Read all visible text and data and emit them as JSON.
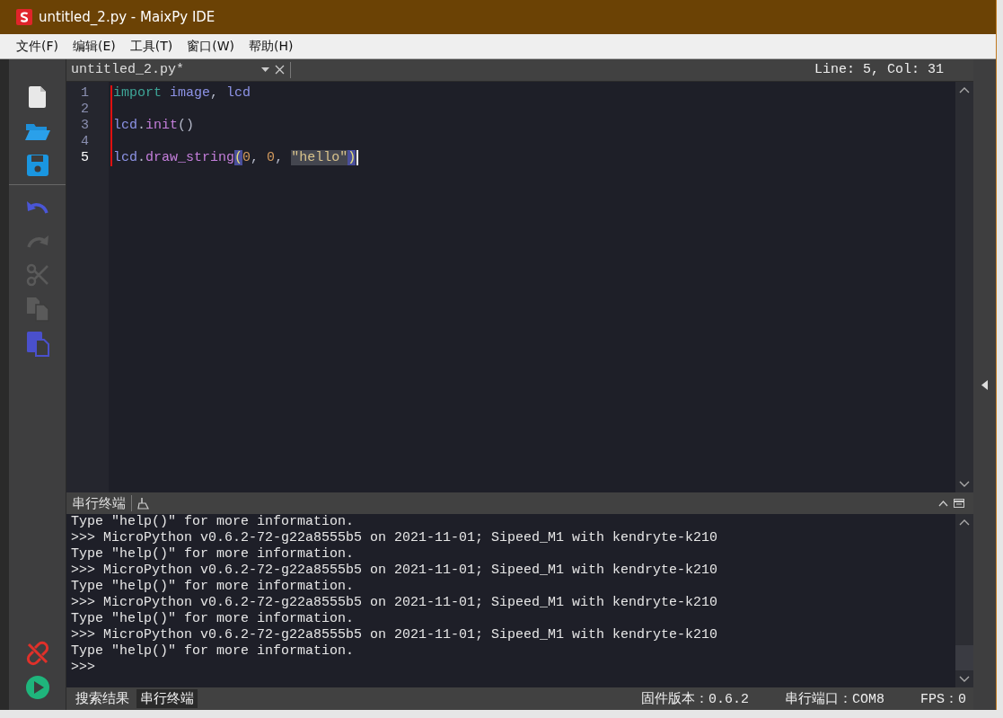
{
  "window": {
    "title": "untitled_2.py - MaixPy IDE"
  },
  "menu": [
    "文件(F)",
    "编辑(E)",
    "工具(T)",
    "窗口(W)",
    "帮助(H)"
  ],
  "toolbar": [
    {
      "kind": "new",
      "disabled": false
    },
    {
      "kind": "open",
      "disabled": false
    },
    {
      "kind": "save",
      "disabled": false
    },
    {
      "kind": "undo",
      "disabled": false
    },
    {
      "kind": "redo",
      "disabled": true
    },
    {
      "kind": "cut",
      "disabled": true
    },
    {
      "kind": "copy",
      "disabled": true
    },
    {
      "kind": "paste",
      "disabled": false
    }
  ],
  "device_buttons": [
    {
      "kind": "disconnect"
    },
    {
      "kind": "run"
    }
  ],
  "editor": {
    "tab": "untitled_2.py*",
    "position": "Line: 5, Col: 31",
    "lines": [
      {
        "number": "1",
        "current": false,
        "tokens": [
          {
            "text": "import",
            "kind": "keyword"
          },
          {
            "text": " image",
            "kind": "name"
          },
          {
            "text": ", ",
            "kind": "plain"
          },
          {
            "text": "lcd",
            "kind": "name"
          }
        ]
      },
      {
        "number": "2",
        "current": false
      },
      {
        "number": "3",
        "current": false,
        "tokens": [
          {
            "text": "lcd",
            "kind": "name"
          },
          {
            "text": ".",
            "kind": "plain"
          },
          {
            "text": "init",
            "kind": "func"
          },
          {
            "text": "()",
            "kind": "plain"
          }
        ]
      },
      {
        "number": "4",
        "current": false
      },
      {
        "number": "5",
        "current": true,
        "tokens": [
          {
            "text": "lcd",
            "kind": "name"
          },
          {
            "text": ".",
            "kind": "plain"
          },
          {
            "text": "draw_string",
            "kind": "func"
          },
          {
            "text": "(",
            "kind": "match"
          },
          {
            "text": "0",
            "kind": "number"
          },
          {
            "text": ", ",
            "kind": "plain"
          },
          {
            "text": "0",
            "kind": "number"
          },
          {
            "text": ", ",
            "kind": "plain"
          },
          {
            "text": "\"hello\"",
            "kind": "selection"
          },
          {
            "text": ")",
            "kind": "match"
          }
        ]
      }
    ]
  },
  "terminal": {
    "title": "串行终端",
    "lines": [
      "Type \"help()\" for more information.",
      ">>> MicroPython v0.6.2-72-g22a8555b5 on 2021-11-01; Sipeed_M1 with kendryte-k210",
      "Type \"help()\" for more information.",
      ">>> MicroPython v0.6.2-72-g22a8555b5 on 2021-11-01; Sipeed_M1 with kendryte-k210",
      "Type \"help()\" for more information.",
      ">>> MicroPython v0.6.2-72-g22a8555b5 on 2021-11-01; Sipeed_M1 with kendryte-k210",
      "Type \"help()\" for more information.",
      ">>> MicroPython v0.6.2-72-g22a8555b5 on 2021-11-01; Sipeed_M1 with kendryte-k210",
      "Type \"help()\" for more information.",
      ">>>"
    ]
  },
  "status_bar": {
    "tabs": [
      {
        "label": "搜索结果",
        "selected": false
      },
      {
        "label": "串行终端",
        "selected": true
      }
    ],
    "items": [
      "固件版本：0.6.2",
      "串行端口：COM8",
      "FPS：0"
    ]
  }
}
